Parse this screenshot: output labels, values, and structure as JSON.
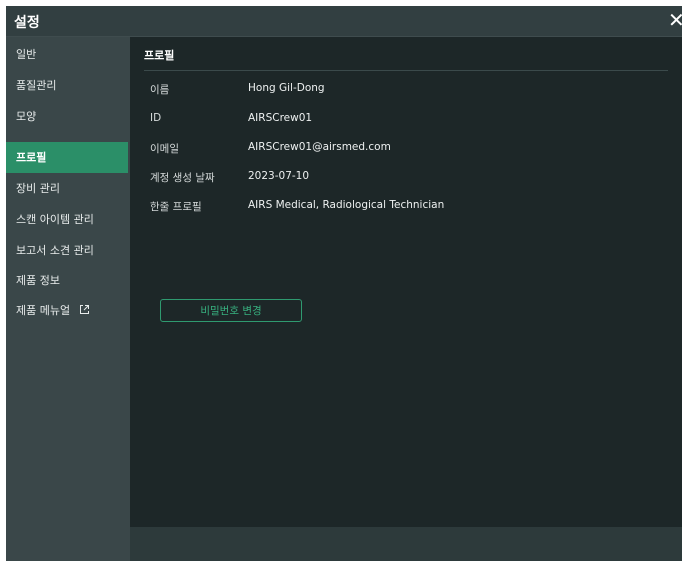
{
  "window": {
    "title": "설정",
    "close_label": "✕"
  },
  "sidebar": {
    "items": [
      {
        "label": "일반",
        "active": false
      },
      {
        "label": "품질관리",
        "active": false
      },
      {
        "label": "모양",
        "active": false
      },
      {
        "label": "프로필",
        "active": true
      },
      {
        "label": "장비 관리",
        "active": false
      },
      {
        "label": "스캔 아이템 관리",
        "active": false
      },
      {
        "label": "보고서 소견 관리",
        "active": false
      },
      {
        "label": "제품 정보",
        "active": false
      },
      {
        "label": "제품 메뉴얼",
        "active": false,
        "icon": "external-link-icon"
      }
    ]
  },
  "profile": {
    "section_title": "프로필",
    "rows": [
      {
        "label": "이름",
        "value": "Hong Gil-Dong"
      },
      {
        "label": "ID",
        "value": "AIRSCrew01"
      },
      {
        "label": "이메일",
        "value": "AIRSCrew01@airsmed.com"
      },
      {
        "label": "계정 생성 날짜",
        "value": "2023-07-10"
      },
      {
        "label": "한줄 프로필",
        "value": "AIRS Medical, Radiological Technician"
      }
    ],
    "change_password_label": "비밀번호 변경"
  },
  "colors": {
    "accent": "#2b8f68",
    "dialog_bg": "#2d3a3b",
    "content_bg": "#1d2728"
  }
}
